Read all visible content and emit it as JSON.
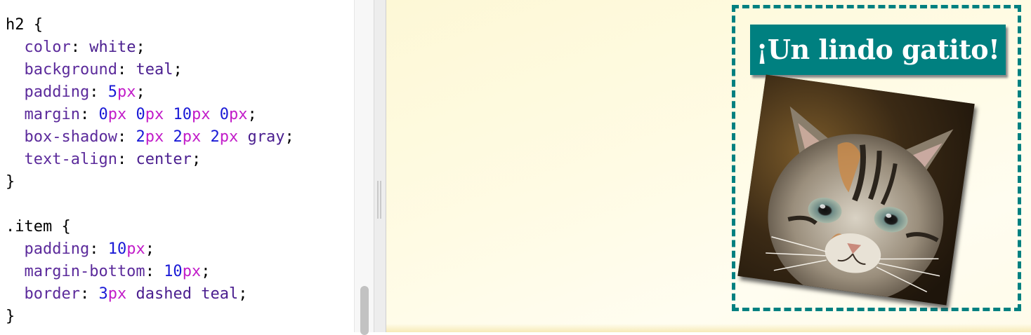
{
  "editor": {
    "lines": [
      {
        "tokens": [
          {
            "t": "h2 ",
            "k": "sel"
          },
          {
            "t": "{",
            "k": "brace"
          }
        ]
      },
      {
        "tokens": [
          {
            "t": "  color",
            "k": "prop"
          },
          {
            "t": ": ",
            "k": "punct"
          },
          {
            "t": "white",
            "k": "val"
          },
          {
            "t": ";",
            "k": "punct"
          }
        ]
      },
      {
        "tokens": [
          {
            "t": "  background",
            "k": "prop"
          },
          {
            "t": ": ",
            "k": "punct"
          },
          {
            "t": "teal",
            "k": "val"
          },
          {
            "t": ";",
            "k": "punct"
          }
        ]
      },
      {
        "tokens": [
          {
            "t": "  padding",
            "k": "prop"
          },
          {
            "t": ": ",
            "k": "punct"
          },
          {
            "t": "5",
            "k": "num"
          },
          {
            "t": "px",
            "k": "unit"
          },
          {
            "t": ";",
            "k": "punct"
          }
        ]
      },
      {
        "tokens": [
          {
            "t": "  margin",
            "k": "prop"
          },
          {
            "t": ": ",
            "k": "punct"
          },
          {
            "t": "0",
            "k": "num"
          },
          {
            "t": "px",
            "k": "unit"
          },
          {
            "t": " ",
            "k": "punct"
          },
          {
            "t": "0",
            "k": "num"
          },
          {
            "t": "px",
            "k": "unit"
          },
          {
            "t": " ",
            "k": "punct"
          },
          {
            "t": "10",
            "k": "num"
          },
          {
            "t": "px",
            "k": "unit"
          },
          {
            "t": " ",
            "k": "punct"
          },
          {
            "t": "0",
            "k": "num"
          },
          {
            "t": "px",
            "k": "unit"
          },
          {
            "t": ";",
            "k": "punct"
          }
        ]
      },
      {
        "tokens": [
          {
            "t": "  box-shadow",
            "k": "prop"
          },
          {
            "t": ": ",
            "k": "punct"
          },
          {
            "t": "2",
            "k": "num"
          },
          {
            "t": "px",
            "k": "unit"
          },
          {
            "t": " ",
            "k": "punct"
          },
          {
            "t": "2",
            "k": "num"
          },
          {
            "t": "px",
            "k": "unit"
          },
          {
            "t": " ",
            "k": "punct"
          },
          {
            "t": "2",
            "k": "num"
          },
          {
            "t": "px",
            "k": "unit"
          },
          {
            "t": " ",
            "k": "punct"
          },
          {
            "t": "gray",
            "k": "val"
          },
          {
            "t": ";",
            "k": "punct"
          }
        ]
      },
      {
        "tokens": [
          {
            "t": "  text-align",
            "k": "prop"
          },
          {
            "t": ": ",
            "k": "punct"
          },
          {
            "t": "center",
            "k": "val"
          },
          {
            "t": ";",
            "k": "punct"
          }
        ]
      },
      {
        "tokens": [
          {
            "t": "}",
            "k": "brace"
          }
        ]
      },
      {
        "tokens": []
      },
      {
        "tokens": [
          {
            "t": ".item ",
            "k": "sel"
          },
          {
            "t": "{",
            "k": "brace"
          }
        ]
      },
      {
        "tokens": [
          {
            "t": "  padding",
            "k": "prop"
          },
          {
            "t": ": ",
            "k": "punct"
          },
          {
            "t": "10",
            "k": "num"
          },
          {
            "t": "px",
            "k": "unit"
          },
          {
            "t": ";",
            "k": "punct"
          }
        ]
      },
      {
        "tokens": [
          {
            "t": "  margin-bottom",
            "k": "prop"
          },
          {
            "t": ": ",
            "k": "punct"
          },
          {
            "t": "10",
            "k": "num"
          },
          {
            "t": "px",
            "k": "unit"
          },
          {
            "t": ";",
            "k": "punct"
          }
        ]
      },
      {
        "tokens": [
          {
            "t": "  border",
            "k": "prop"
          },
          {
            "t": ": ",
            "k": "punct"
          },
          {
            "t": "3",
            "k": "num"
          },
          {
            "t": "px",
            "k": "unit"
          },
          {
            "t": " ",
            "k": "punct"
          },
          {
            "t": "dashed",
            "k": "val"
          },
          {
            "t": " ",
            "k": "punct"
          },
          {
            "t": "teal",
            "k": "val"
          },
          {
            "t": ";",
            "k": "punct"
          }
        ]
      },
      {
        "tokens": [
          {
            "t": "}",
            "k": "brace"
          }
        ]
      }
    ]
  },
  "preview": {
    "heading": "¡Un lindo gatito!",
    "image_icon": "kitten-photo"
  },
  "colors": {
    "teal": "#008080",
    "heading_text": "#ffffff",
    "preview_bg": "#fffbe4"
  }
}
